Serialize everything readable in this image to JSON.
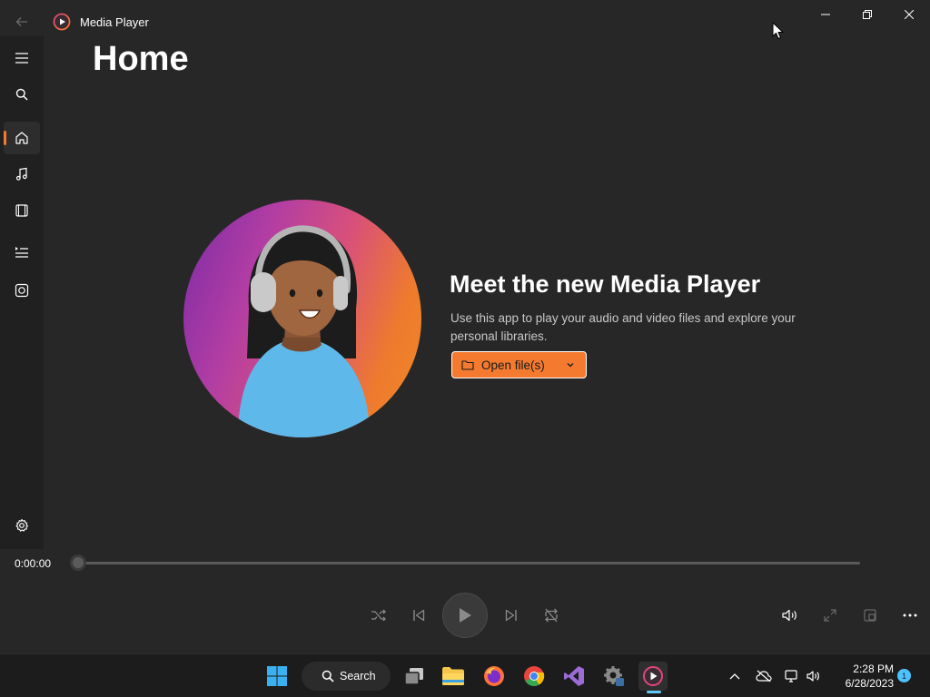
{
  "window": {
    "app_title": "Media Player",
    "controls": [
      "minimize",
      "restore",
      "close"
    ]
  },
  "sidebar": {
    "items": [
      {
        "name": "menu",
        "icon": "hamburger-icon"
      },
      {
        "name": "search",
        "icon": "search-icon"
      },
      {
        "name": "home",
        "icon": "home-icon",
        "active": true
      },
      {
        "name": "music-library",
        "icon": "music-note-icon"
      },
      {
        "name": "video-library",
        "icon": "film-icon"
      },
      {
        "name": "play-queue",
        "icon": "queue-icon"
      },
      {
        "name": "playlists",
        "icon": "playlist-icon"
      },
      {
        "name": "settings",
        "icon": "gear-icon"
      }
    ]
  },
  "main": {
    "page_title": "Home",
    "hero": {
      "heading": "Meet the new Media Player",
      "description": "Use this app to play your audio and video files and explore your personal libraries.",
      "open_button_label": "Open file(s)"
    }
  },
  "playback": {
    "current_time": "0:00:00",
    "progress": 0,
    "controls": [
      "shuffle",
      "previous",
      "play",
      "next",
      "repeat"
    ],
    "right_controls": [
      "volume",
      "full-screen",
      "mini-player",
      "more"
    ]
  },
  "taskbar": {
    "search_label": "Search",
    "apps": [
      "start",
      "search",
      "task-view",
      "file-explorer",
      "firefox",
      "chrome",
      "visual-studio",
      "settings",
      "media-player"
    ],
    "active_app": "media-player",
    "clock_time": "2:28 PM",
    "clock_date": "6/28/2023",
    "notification_count": "1"
  },
  "colors": {
    "accent": "#f47a2f",
    "background": "#272727",
    "sidebar": "#202020",
    "taskbar": "#1c1c1c",
    "taskbar_active": "#60c8f0"
  }
}
